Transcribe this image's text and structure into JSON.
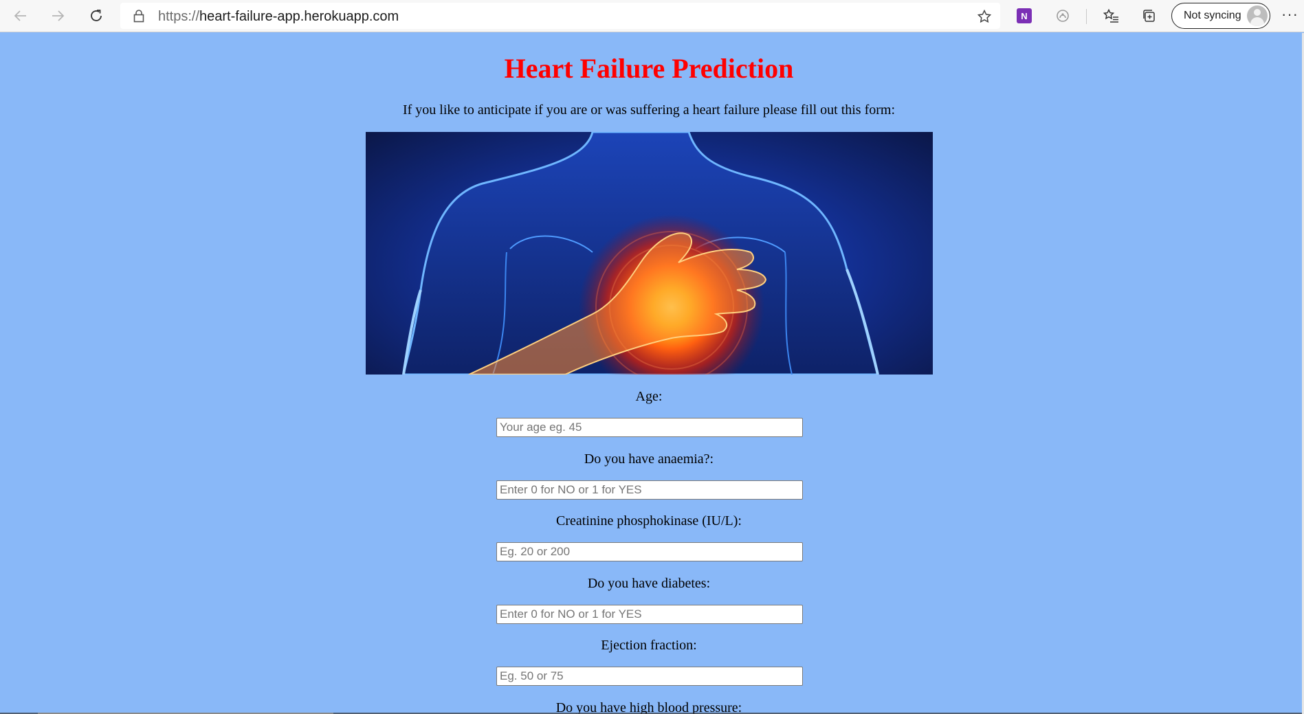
{
  "browser": {
    "url_scheme": "https://",
    "url_host": "heart-failure-app.herokuapp.com",
    "profile_label": "Not syncing",
    "onenote_letter": "N",
    "more_label": "···"
  },
  "page": {
    "title": "Heart Failure Prediction",
    "intro": "If you like to anticipate if you are or was suffering a heart failure please fill out this form:"
  },
  "form": {
    "fields": [
      {
        "label": "Age:",
        "placeholder": "Your age eg. 45"
      },
      {
        "label": "Do you have anaemia?:",
        "placeholder": "Enter 0 for NO or 1 for YES"
      },
      {
        "label": "Creatinine phosphokinase (IU/L):",
        "placeholder": "Eg. 20 or 200"
      },
      {
        "label": "Do you have diabetes:",
        "placeholder": "Enter 0 for NO or 1 for YES"
      },
      {
        "label": "Ejection fraction:",
        "placeholder": "Eg. 50 or 75"
      },
      {
        "label": "Do you have high blood pressure:"
      }
    ]
  },
  "colors": {
    "page_background": "#89b8f8",
    "title": "#ff0000"
  }
}
